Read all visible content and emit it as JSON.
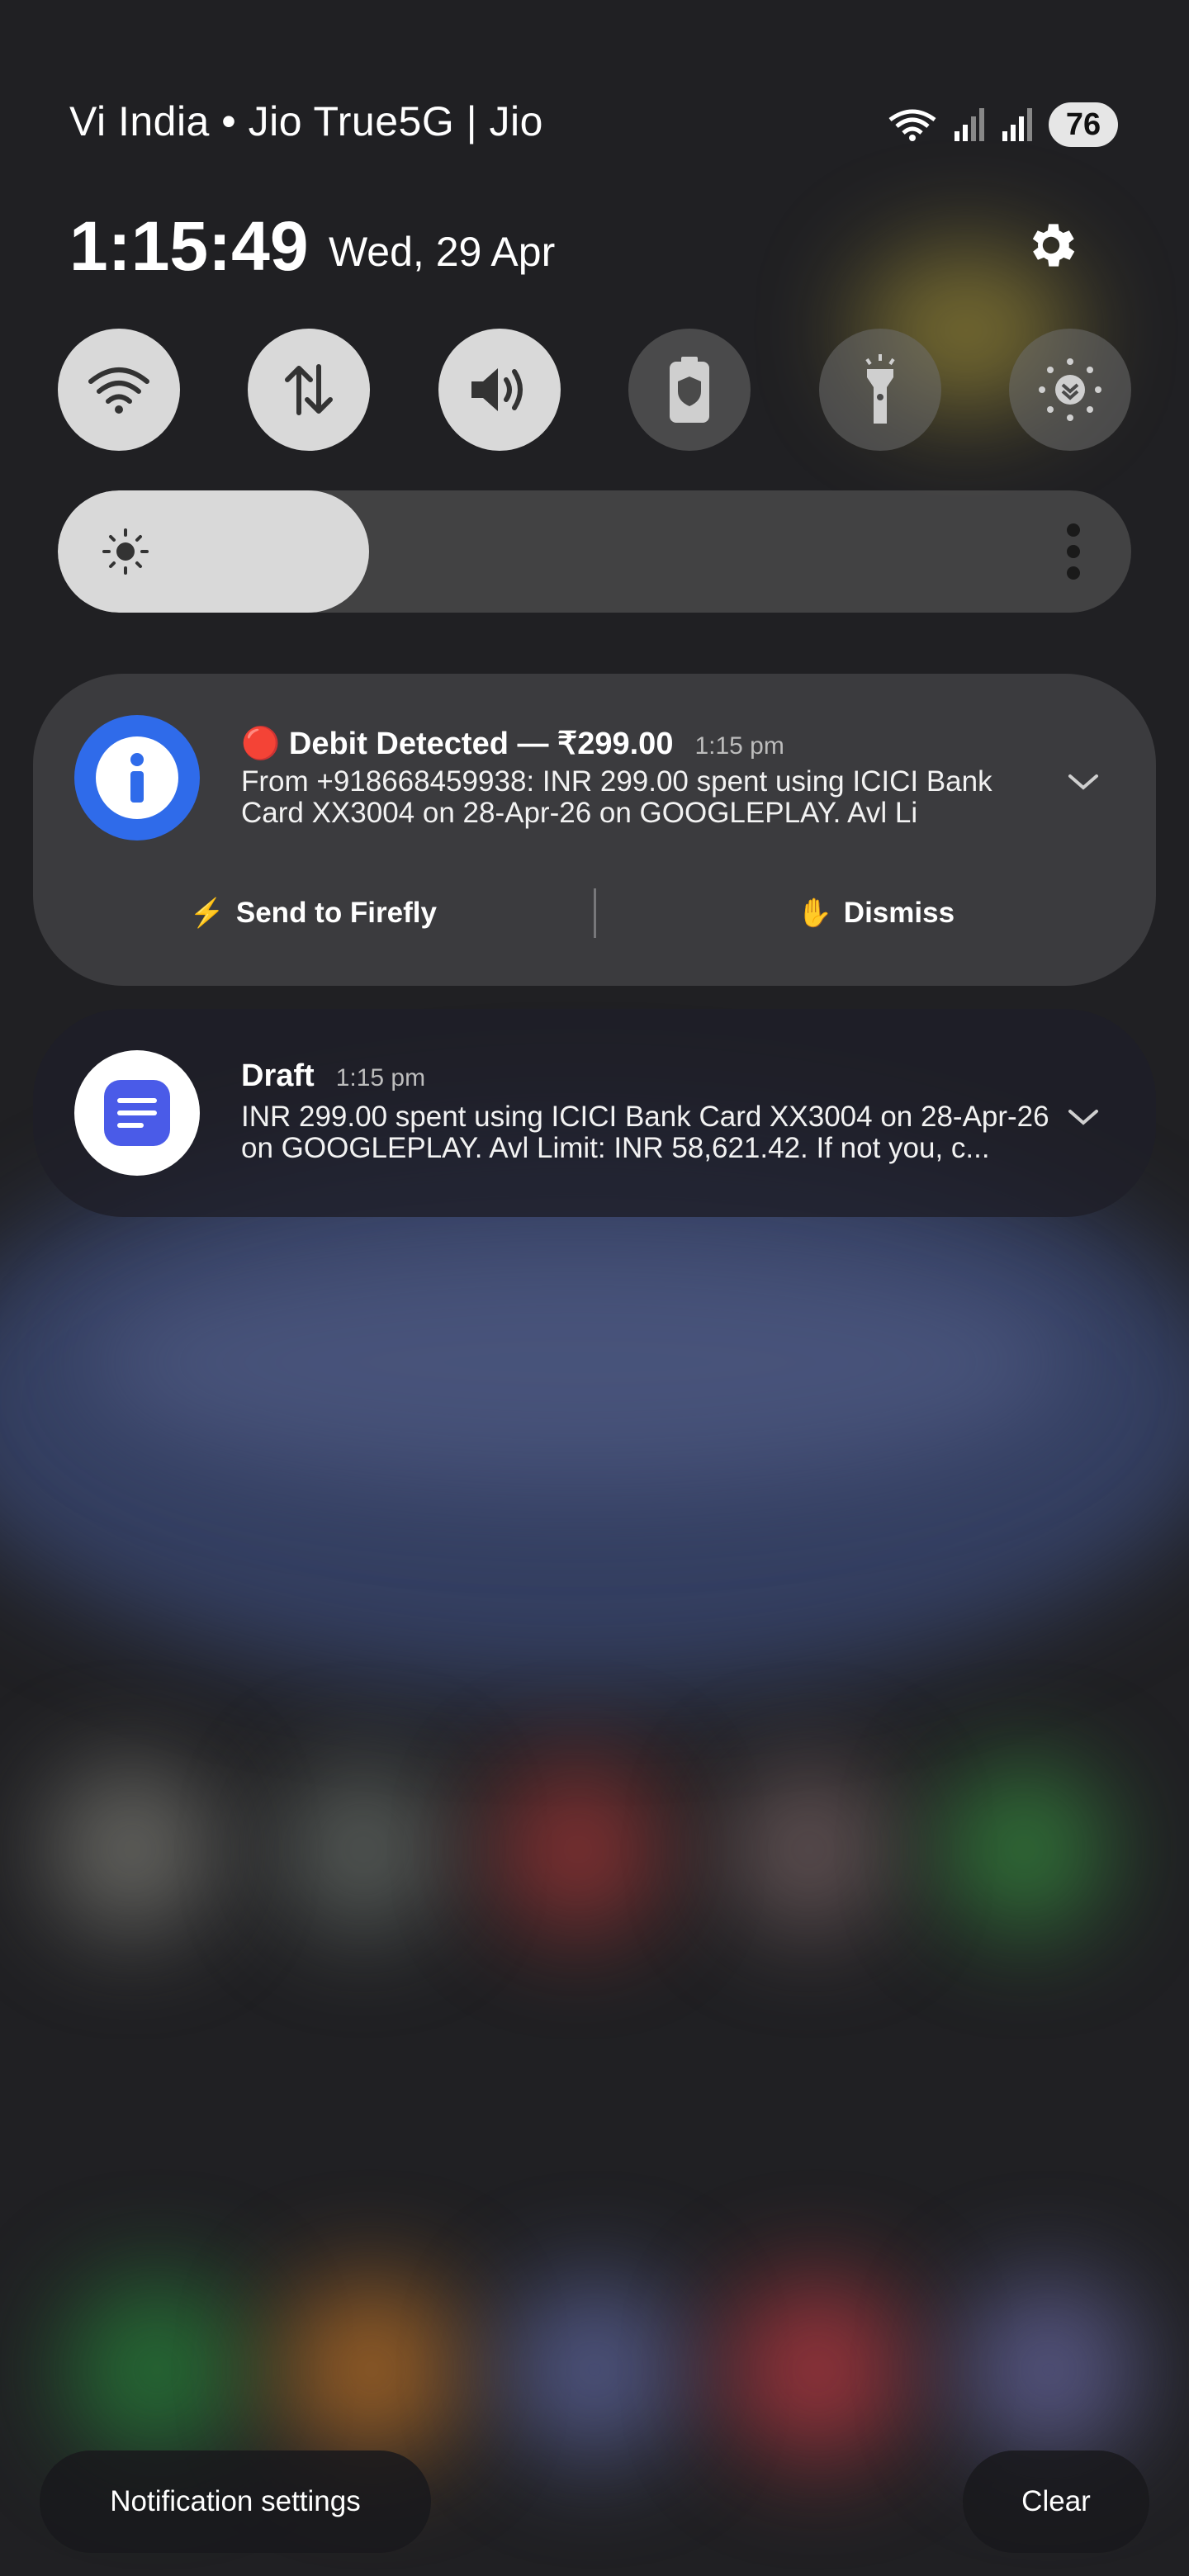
{
  "status_bar": {
    "carrier": "Vi India • Jio True5G | Jio",
    "battery": "76",
    "icons": [
      "wifi-data-icon",
      "signal-bars-icon",
      "signal-bars-icon",
      "battery-icon"
    ]
  },
  "header": {
    "time": "1:15:49",
    "date": "Wed, 29 Apr",
    "settings_icon": "gear-icon"
  },
  "quick_settings": {
    "tiles": [
      {
        "icon": "wifi-icon",
        "state": "on"
      },
      {
        "icon": "mobile-data-icon",
        "state": "on"
      },
      {
        "icon": "sound-icon",
        "state": "on"
      },
      {
        "icon": "battery-saver-icon",
        "state": "off"
      },
      {
        "icon": "flashlight-icon",
        "state": "off"
      },
      {
        "icon": "eye-comfort-icon",
        "state": "off"
      }
    ],
    "brightness_level": 0.29
  },
  "notifications": [
    {
      "title": "🔴 Debit Detected — ₹299.00",
      "time": "1:15 pm",
      "body": "From +918668459938: INR 299.00 spent using ICICI Bank Card XX3004 on 28-Apr-26 on GOOGLEPLAY. Avl Li",
      "app_icon": "info-icon",
      "actions": [
        {
          "emoji": "⚡",
          "label": "Send to Firefly"
        },
        {
          "emoji": "✋",
          "label": "Dismiss"
        }
      ]
    },
    {
      "title": "Draft",
      "time": "1:15 pm",
      "body": "INR 299.00 spent using ICICI Bank Card XX3004 on 28-Apr-26 on GOOGLEPLAY. Avl Limit: INR 58,621.42. If not you, c...",
      "app_icon": "notes-icon"
    }
  ],
  "footer": {
    "settings_label": "Notification settings",
    "clear_label": "Clear"
  },
  "colors": {
    "accent_blue": "#2f6bea",
    "tile_on": "#d9d9d9",
    "card_bg": "#3b3b3e"
  }
}
